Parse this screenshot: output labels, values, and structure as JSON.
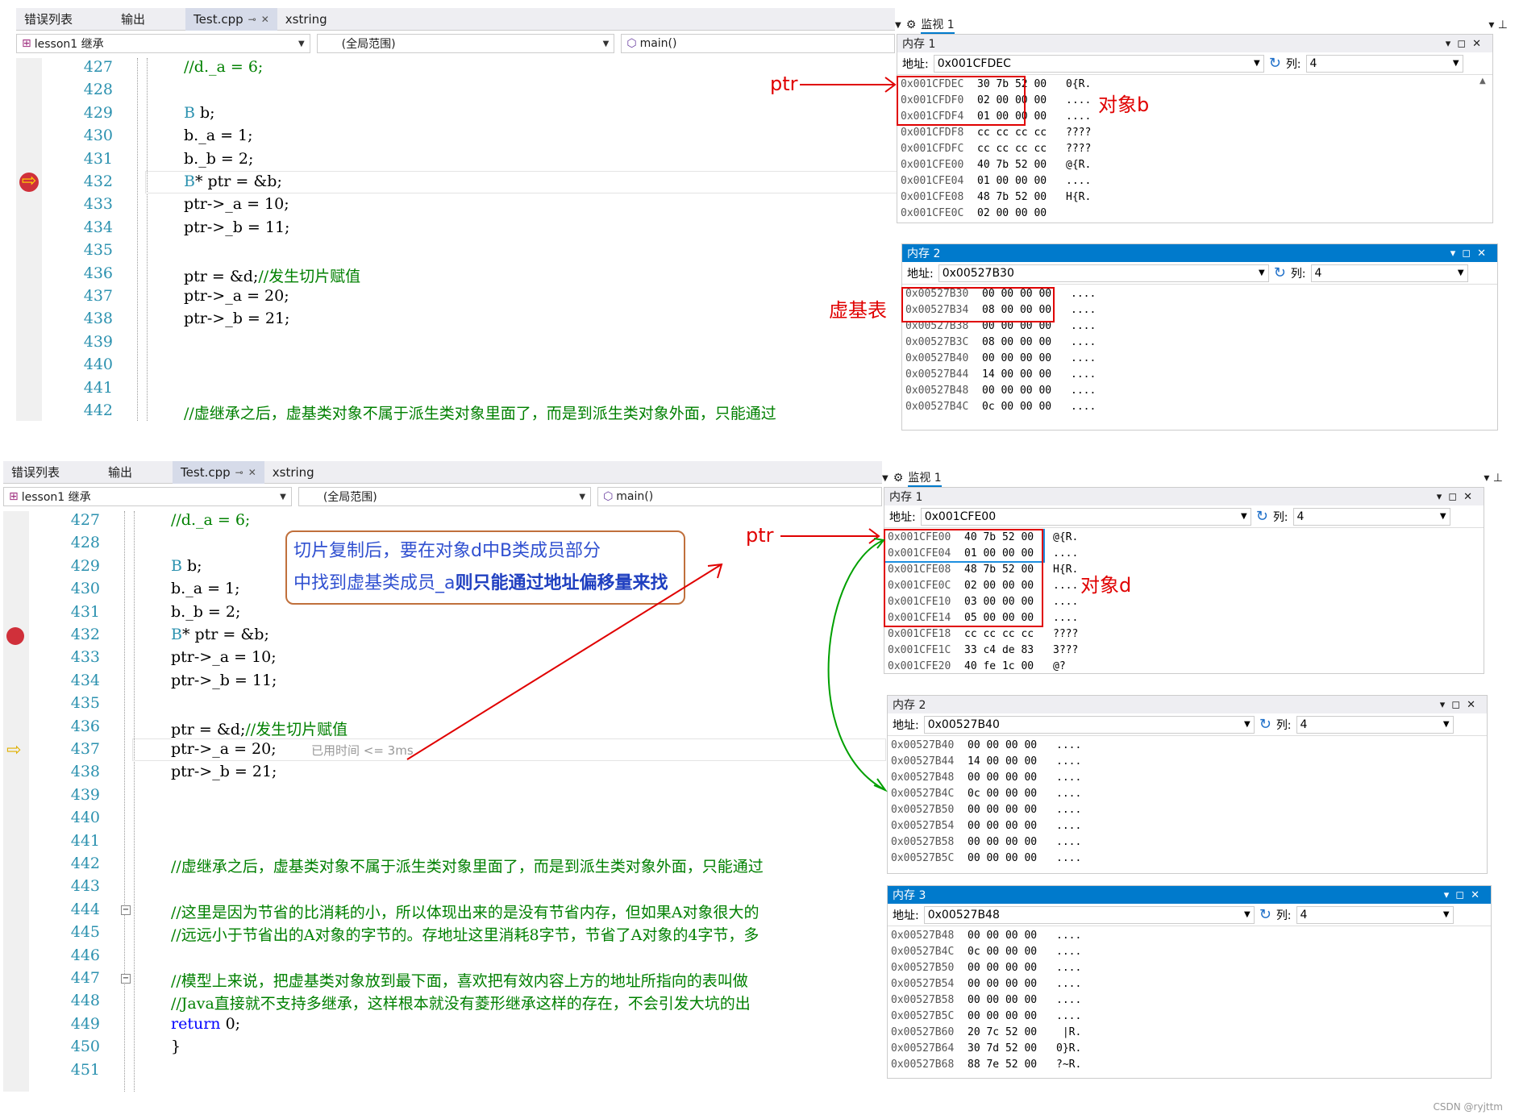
{
  "common": {
    "tabs": [
      "错误列表",
      "输出",
      "Test.cpp",
      "xstring"
    ],
    "dropdowns": [
      "lesson1 继承",
      "(全局范围)",
      "main()"
    ],
    "watch": "监视 1",
    "addr_label": "地址:",
    "col_label": "列:",
    "col_value": "4"
  },
  "shot1": {
    "lines": [
      {
        "n": "427",
        "code": "//d._a = 6;",
        "cls": "cmt"
      },
      {
        "n": "428",
        "code": "",
        "cls": ""
      },
      {
        "n": "429",
        "code": "B b;",
        "cls": ""
      },
      {
        "n": "430",
        "code": "b._a = 1;",
        "cls": ""
      },
      {
        "n": "431",
        "code": "b._b = 2;",
        "cls": ""
      },
      {
        "n": "432",
        "code": "B* ptr = &b;",
        "cls": ""
      },
      {
        "n": "433",
        "code": "ptr->_a = 10;",
        "cls": ""
      },
      {
        "n": "434",
        "code": "ptr->_b = 11;",
        "cls": ""
      },
      {
        "n": "435",
        "code": "",
        "cls": ""
      },
      {
        "n": "436",
        "code": "ptr = &d;//发生切片赋值",
        "cls": "mix"
      },
      {
        "n": "437",
        "code": "ptr->_a = 20;",
        "cls": ""
      },
      {
        "n": "438",
        "code": "ptr->_b = 21;",
        "cls": ""
      },
      {
        "n": "439",
        "code": "",
        "cls": ""
      },
      {
        "n": "440",
        "code": "",
        "cls": ""
      },
      {
        "n": "441",
        "code": "",
        "cls": ""
      },
      {
        "n": "442",
        "code": "//虚继承之后，虚基类对象不属于派生类对象里面了，而是到派生类对象外面，只能通过",
        "cls": "cmt"
      }
    ],
    "mem1": {
      "title": "内存 1",
      "address": "0x001CFDEC",
      "rows": [
        [
          "0x001CFDEC",
          "30 7b 52 00",
          "0{R."
        ],
        [
          "0x001CFDF0",
          "02 00 00 00",
          "...."
        ],
        [
          "0x001CFDF4",
          "01 00 00 00",
          "...."
        ],
        [
          "0x001CFDF8",
          "cc cc cc cc",
          "????"
        ],
        [
          "0x001CFDFC",
          "cc cc cc cc",
          "????"
        ],
        [
          "0x001CFE00",
          "40 7b 52 00",
          "@{R."
        ],
        [
          "0x001CFE04",
          "01 00 00 00",
          "...."
        ],
        [
          "0x001CFE08",
          "48 7b 52 00",
          "H{R."
        ],
        [
          "0x001CFE0C",
          "02 00 00 00",
          ""
        ]
      ]
    },
    "mem2": {
      "title": "内存 2",
      "address": "0x00527B30",
      "rows": [
        [
          "0x00527B30",
          "00 00 00 00",
          "...."
        ],
        [
          "0x00527B34",
          "08 00 00 00",
          "...."
        ],
        [
          "0x00527B38",
          "00 00 00 00",
          "...."
        ],
        [
          "0x00527B3C",
          "08 00 00 00",
          "...."
        ],
        [
          "0x00527B40",
          "00 00 00 00",
          "...."
        ],
        [
          "0x00527B44",
          "14 00 00 00",
          "...."
        ],
        [
          "0x00527B48",
          "00 00 00 00",
          "...."
        ],
        [
          "0x00527B4C",
          "0c 00 00 00",
          "...."
        ]
      ]
    },
    "annot_ptr": "ptr",
    "annot_obj": "对象b",
    "annot_vbt": "虚基表"
  },
  "shot2": {
    "lines": [
      {
        "n": "427",
        "code": "//d._a = 6;",
        "cls": "cmt"
      },
      {
        "n": "428",
        "code": "",
        "cls": ""
      },
      {
        "n": "429",
        "code": "B b;",
        "cls": ""
      },
      {
        "n": "430",
        "code": "b._a = 1;",
        "cls": ""
      },
      {
        "n": "431",
        "code": "b._b = 2;",
        "cls": ""
      },
      {
        "n": "432",
        "code": "B* ptr = &b;",
        "cls": ""
      },
      {
        "n": "433",
        "code": "ptr->_a = 10;",
        "cls": ""
      },
      {
        "n": "434",
        "code": "ptr->_b = 11;",
        "cls": ""
      },
      {
        "n": "435",
        "code": "",
        "cls": ""
      },
      {
        "n": "436",
        "code": "ptr = &d;//发生切片赋值",
        "cls": "mix"
      },
      {
        "n": "437",
        "code": "ptr->_a = 20;",
        "cls": ""
      },
      {
        "n": "438",
        "code": "ptr->_b = 21;",
        "cls": ""
      },
      {
        "n": "439",
        "code": "",
        "cls": ""
      },
      {
        "n": "440",
        "code": "",
        "cls": ""
      },
      {
        "n": "441",
        "code": "",
        "cls": ""
      },
      {
        "n": "442",
        "code": "//虚继承之后，虚基类对象不属于派生类对象里面了，而是到派生类对象外面，只能通过",
        "cls": "cmt"
      },
      {
        "n": "443",
        "code": "",
        "cls": ""
      },
      {
        "n": "444",
        "code": "//这里是因为节省的比消耗的小，所以体现出来的是没有节省内存，但如果A对象很大的",
        "cls": "cmt"
      },
      {
        "n": "445",
        "code": "//远远小于节省出的A对象的字节的。存地址这里消耗8字节，节省了A对象的4字节，多",
        "cls": "cmt"
      },
      {
        "n": "446",
        "code": "",
        "cls": ""
      },
      {
        "n": "447",
        "code": "//模型上来说，把虚基类对象放到最下面，喜欢把有效内容上方的地址所指向的表叫做",
        "cls": "cmt"
      },
      {
        "n": "448",
        "code": "//Java直接就不支持多继承，这样根本就没有菱形继承这样的存在，不会引发大坑的出",
        "cls": "cmt"
      },
      {
        "n": "449",
        "code": "return 0;",
        "cls": "kw"
      },
      {
        "n": "450",
        "code": "}",
        "cls": ""
      },
      {
        "n": "451",
        "code": "",
        "cls": ""
      }
    ],
    "elapsed": "已用时间 <= 3ms",
    "mem1": {
      "title": "内存 1",
      "address": "0x001CFE00",
      "rows": [
        [
          "0x001CFE00",
          "40 7b 52 00",
          "@{R."
        ],
        [
          "0x001CFE04",
          "01 00 00 00",
          "...."
        ],
        [
          "0x001CFE08",
          "48 7b 52 00",
          "H{R."
        ],
        [
          "0x001CFE0C",
          "02 00 00 00",
          "...."
        ],
        [
          "0x001CFE10",
          "03 00 00 00",
          "...."
        ],
        [
          "0x001CFE14",
          "05 00 00 00",
          "...."
        ],
        [
          "0x001CFE18",
          "cc cc cc cc",
          "????"
        ],
        [
          "0x001CFE1C",
          "33 c4 de 83",
          "3???"
        ],
        [
          "0x001CFE20",
          "40 fe 1c 00",
          "@?"
        ]
      ]
    },
    "mem2": {
      "title": "内存 2",
      "address": "0x00527B40",
      "rows": [
        [
          "0x00527B40",
          "00 00 00 00",
          "...."
        ],
        [
          "0x00527B44",
          "14 00 00 00",
          "...."
        ],
        [
          "0x00527B48",
          "00 00 00 00",
          "...."
        ],
        [
          "0x00527B4C",
          "0c 00 00 00",
          "...."
        ],
        [
          "0x00527B50",
          "00 00 00 00",
          "...."
        ],
        [
          "0x00527B54",
          "00 00 00 00",
          "...."
        ],
        [
          "0x00527B58",
          "00 00 00 00",
          "...."
        ],
        [
          "0x00527B5C",
          "00 00 00 00",
          "...."
        ]
      ]
    },
    "mem3": {
      "title": "内存 3",
      "address": "0x00527B48",
      "rows": [
        [
          "0x00527B48",
          "00 00 00 00",
          "...."
        ],
        [
          "0x00527B4C",
          "0c 00 00 00",
          "...."
        ],
        [
          "0x00527B50",
          "00 00 00 00",
          "...."
        ],
        [
          "0x00527B54",
          "00 00 00 00",
          "...."
        ],
        [
          "0x00527B58",
          "00 00 00 00",
          "...."
        ],
        [
          "0x00527B5C",
          "00 00 00 00",
          "...."
        ],
        [
          "0x00527B60",
          "20 7c 52 00",
          " |R."
        ],
        [
          "0x00527B64",
          "30 7d 52 00",
          "0}R."
        ],
        [
          "0x00527B68",
          "88 7e 52 00",
          "?~R."
        ]
      ]
    },
    "annot_ptr": "ptr",
    "annot_obj": "对象d",
    "bubble_line1": "切片复制后，要在对象d中B类成员部分",
    "bubble_line2a": "中找到虚基类成员_a",
    "bubble_line2b": "则只能通过地址偏移量来找"
  },
  "footer": "CSDN @ryjttm",
  "colors": {
    "red": "#e00000",
    "blue": "#1e8fe0",
    "green": "#00a000",
    "vs_blue": "#007acc"
  }
}
